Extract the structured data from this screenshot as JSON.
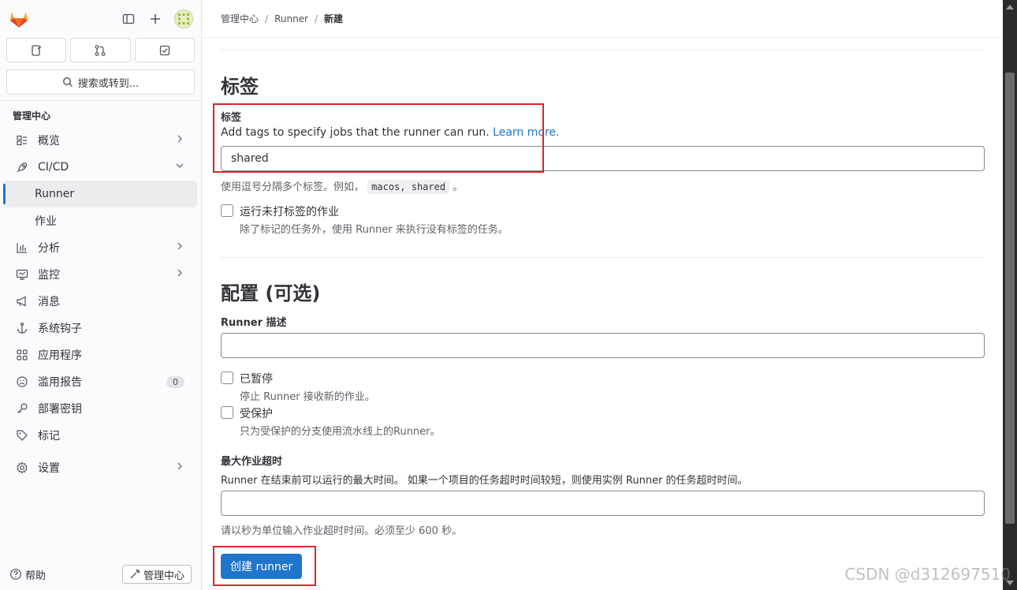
{
  "breadcrumb": [
    "管理中心",
    "Runner",
    "新建"
  ],
  "sidebar": {
    "search_label": "搜索或转到...",
    "section_title": "管理中心",
    "items": [
      {
        "label": "概览",
        "icon": "overview-icon",
        "chevron": "right"
      },
      {
        "label": "CI/CD",
        "icon": "rocket-icon",
        "chevron": "down"
      },
      {
        "label": "Runner",
        "icon": "",
        "active": true
      },
      {
        "label": "作业",
        "icon": ""
      },
      {
        "label": "分析",
        "icon": "chart-icon",
        "chevron": "right"
      },
      {
        "label": "监控",
        "icon": "monitor-icon",
        "chevron": "right"
      },
      {
        "label": "消息",
        "icon": "bullhorn-icon"
      },
      {
        "label": "系统钩子",
        "icon": "anchor-icon"
      },
      {
        "label": "应用程序",
        "icon": "apps-icon"
      },
      {
        "label": "滥用报告",
        "icon": "abuse-icon",
        "badge": "0"
      },
      {
        "label": "部署密钥",
        "icon": "key-icon"
      },
      {
        "label": "标记",
        "icon": "label-icon"
      },
      {
        "label": "设置",
        "icon": "gear-icon",
        "chevron": "right"
      }
    ],
    "help_label": "帮助",
    "admin_label": "管理中心"
  },
  "tags_section": {
    "title": "标签",
    "field_label": "标签",
    "description": "Add tags to specify jobs that the runner can run.",
    "learn_more": "Learn more.",
    "value": "shared",
    "hint_prefix": "使用逗号分隔多个标签。例如，",
    "hint_code": "macos, shared",
    "hint_suffix": "。",
    "untagged_label": "运行未打标签的作业",
    "untagged_help": "除了标记的任务外，使用 Runner 来执行没有标签的任务。"
  },
  "config_section": {
    "title": "配置 (可选)",
    "desc_label": "Runner 描述",
    "desc_value": "",
    "paused_label": "已暂停",
    "paused_help": "停止 Runner 接收新的作业。",
    "protected_label": "受保护",
    "protected_help": "只为受保护的分支使用流水线上的Runner。",
    "timeout_label": "最大作业超时",
    "timeout_desc": "Runner 在结束前可以运行的最大时间。 如果一个项目的任务超时时间较短，则使用实例 Runner 的任务超时时间。",
    "timeout_value": "",
    "timeout_help": "请以秒为单位输入作业超时时间。必须至少 600 秒。"
  },
  "submit_label": "创建 runner",
  "watermark": "CSDN @d312697510",
  "colors": {
    "accent": "#1f75cb",
    "highlight_box": "#d9252c"
  }
}
